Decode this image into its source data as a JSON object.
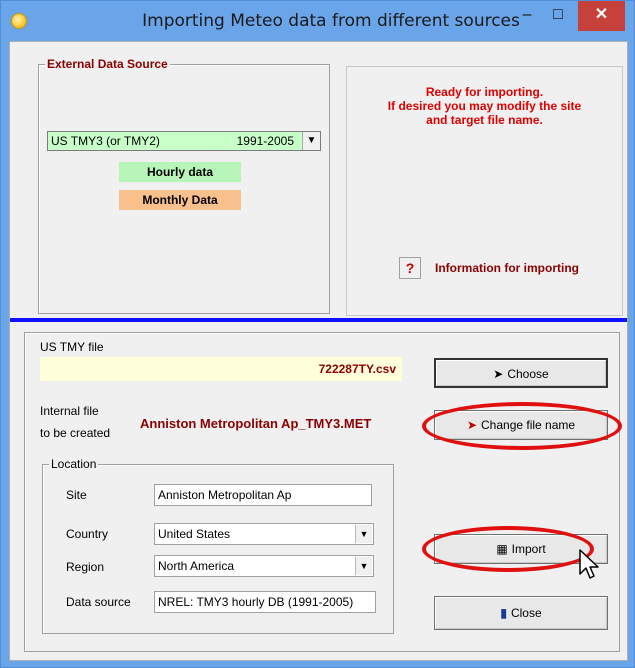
{
  "window": {
    "title": "Importing Meteo data from different sources"
  },
  "external_source": {
    "legend": "External Data Source",
    "selected_source": "US TMY3 (or TMY2)",
    "selected_years": "1991-2005",
    "hourly_label": "Hourly data",
    "monthly_label": "Monthly Data"
  },
  "status": {
    "lines": [
      "Ready for importing.",
      "If desired you may modify the site",
      "and target file name."
    ],
    "info_button": "?",
    "info_label": "Information for importing"
  },
  "file": {
    "label": "US TMY file",
    "value": "722287TY.csv",
    "choose_label": "Choose"
  },
  "internal_file": {
    "label_line1": "Internal file",
    "label_line2": "to be created",
    "value": "Anniston Metropolitan Ap_TMY3.MET",
    "change_label": "Change file name"
  },
  "location": {
    "legend": "Location",
    "site_label": "Site",
    "site_value": "Anniston Metropolitan Ap",
    "country_label": "Country",
    "country_value": "United States",
    "region_label": "Region",
    "region_value": "North America",
    "source_label": "Data source",
    "source_value": "NREL: TMY3 hourly DB (1991-2005)"
  },
  "actions": {
    "import_label": "Import",
    "close_label": "Close"
  },
  "colors": {
    "title_bar": "#6aa5ea",
    "close_button": "#c7413b",
    "separator": "#1010ff",
    "status_text": "#e00000",
    "highlight_ring": "#e01010",
    "hourly_tag": "#b8f5b8",
    "monthly_tag": "#f8c08c",
    "file_field": "#ffffdc"
  },
  "icons": {
    "app": "sun-icon",
    "choose": "arrow-right-icon",
    "change": "rename-icon",
    "import": "import-icon",
    "close": "exit-door-icon"
  }
}
